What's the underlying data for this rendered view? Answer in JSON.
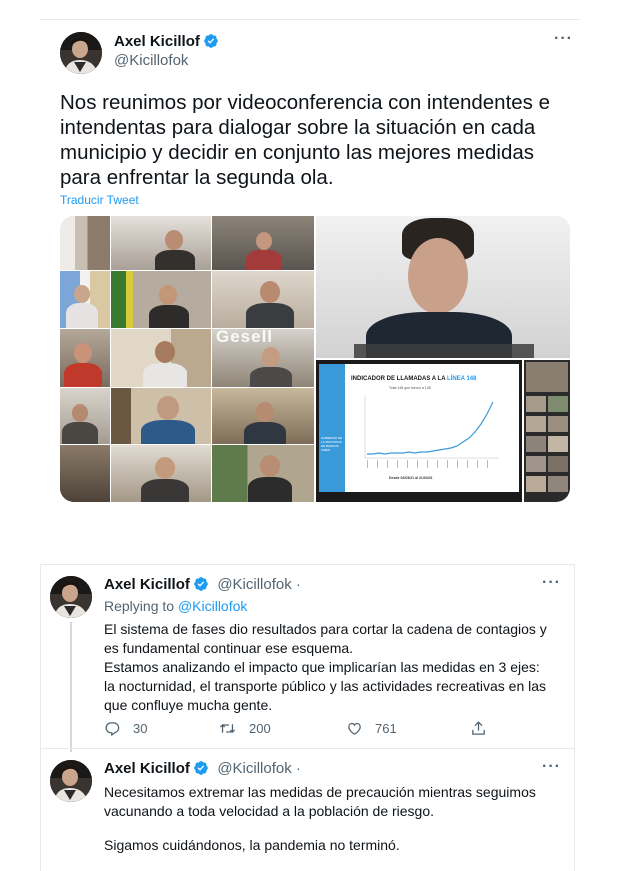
{
  "main_tweet": {
    "author_name": "Axel Kicillof",
    "author_handle": "@Kicillofok",
    "text": "Nos reunimos por videoconferencia con intendentes e intendentas para dialogar sobre la situación en cada municipio y decidir en conjunto las mejores medidas para enfrentar la segunda ola.",
    "translate_label": "Traducir Tweet",
    "media": {
      "video_tile_label": "Gesell",
      "chart_slide_title": "INDICADOR DE LLAMADAS A LA",
      "chart_slide_title_highlight": "LÍNEA 148",
      "chart_slide_subtitle": "Total 148 que fueron a 148",
      "chart_slide_footer": "Desde 02/03/21 al 21/04/21",
      "slide_logo_text": "GOBIERNO DE LA PROVINCIA DE BUENOS AIRES"
    }
  },
  "reply_1": {
    "author_name": "Axel Kicillof",
    "author_handle": "@Kicillofok ·",
    "replying_prefix": "Replying to",
    "replying_handle": "@Kicillofok",
    "paragraph_1": "El sistema de fases dio resultados para cortar la cadena de contagios y es fundamental continuar ese esquema.",
    "paragraph_2": "Estamos analizando el impacto que implicarían las medidas en 3 ejes: la nocturnidad, el transporte público y las actividades recreativas en las que confluye mucha gente.",
    "reply_count": "30",
    "retweet_count": "200",
    "like_count": "761"
  },
  "reply_2": {
    "author_name": "Axel Kicillof",
    "author_handle": "@Kicillofok ·",
    "paragraph_1": "Necesitamos extremar las medidas de precaución mientras seguimos vacunando a toda velocidad a la población de riesgo.",
    "paragraph_2": "Sigamos cuidándonos, la pandemia no terminó."
  },
  "icons": {
    "verified": "verified-badge-icon",
    "more": "more-dots-icon",
    "reply": "reply-icon",
    "retweet": "retweet-icon",
    "like": "heart-icon",
    "share": "share-icon"
  },
  "colors": {
    "accent": "#1d9bf0",
    "text": "#0f1419",
    "secondary": "#536471",
    "divider": "#e7e9ea"
  }
}
